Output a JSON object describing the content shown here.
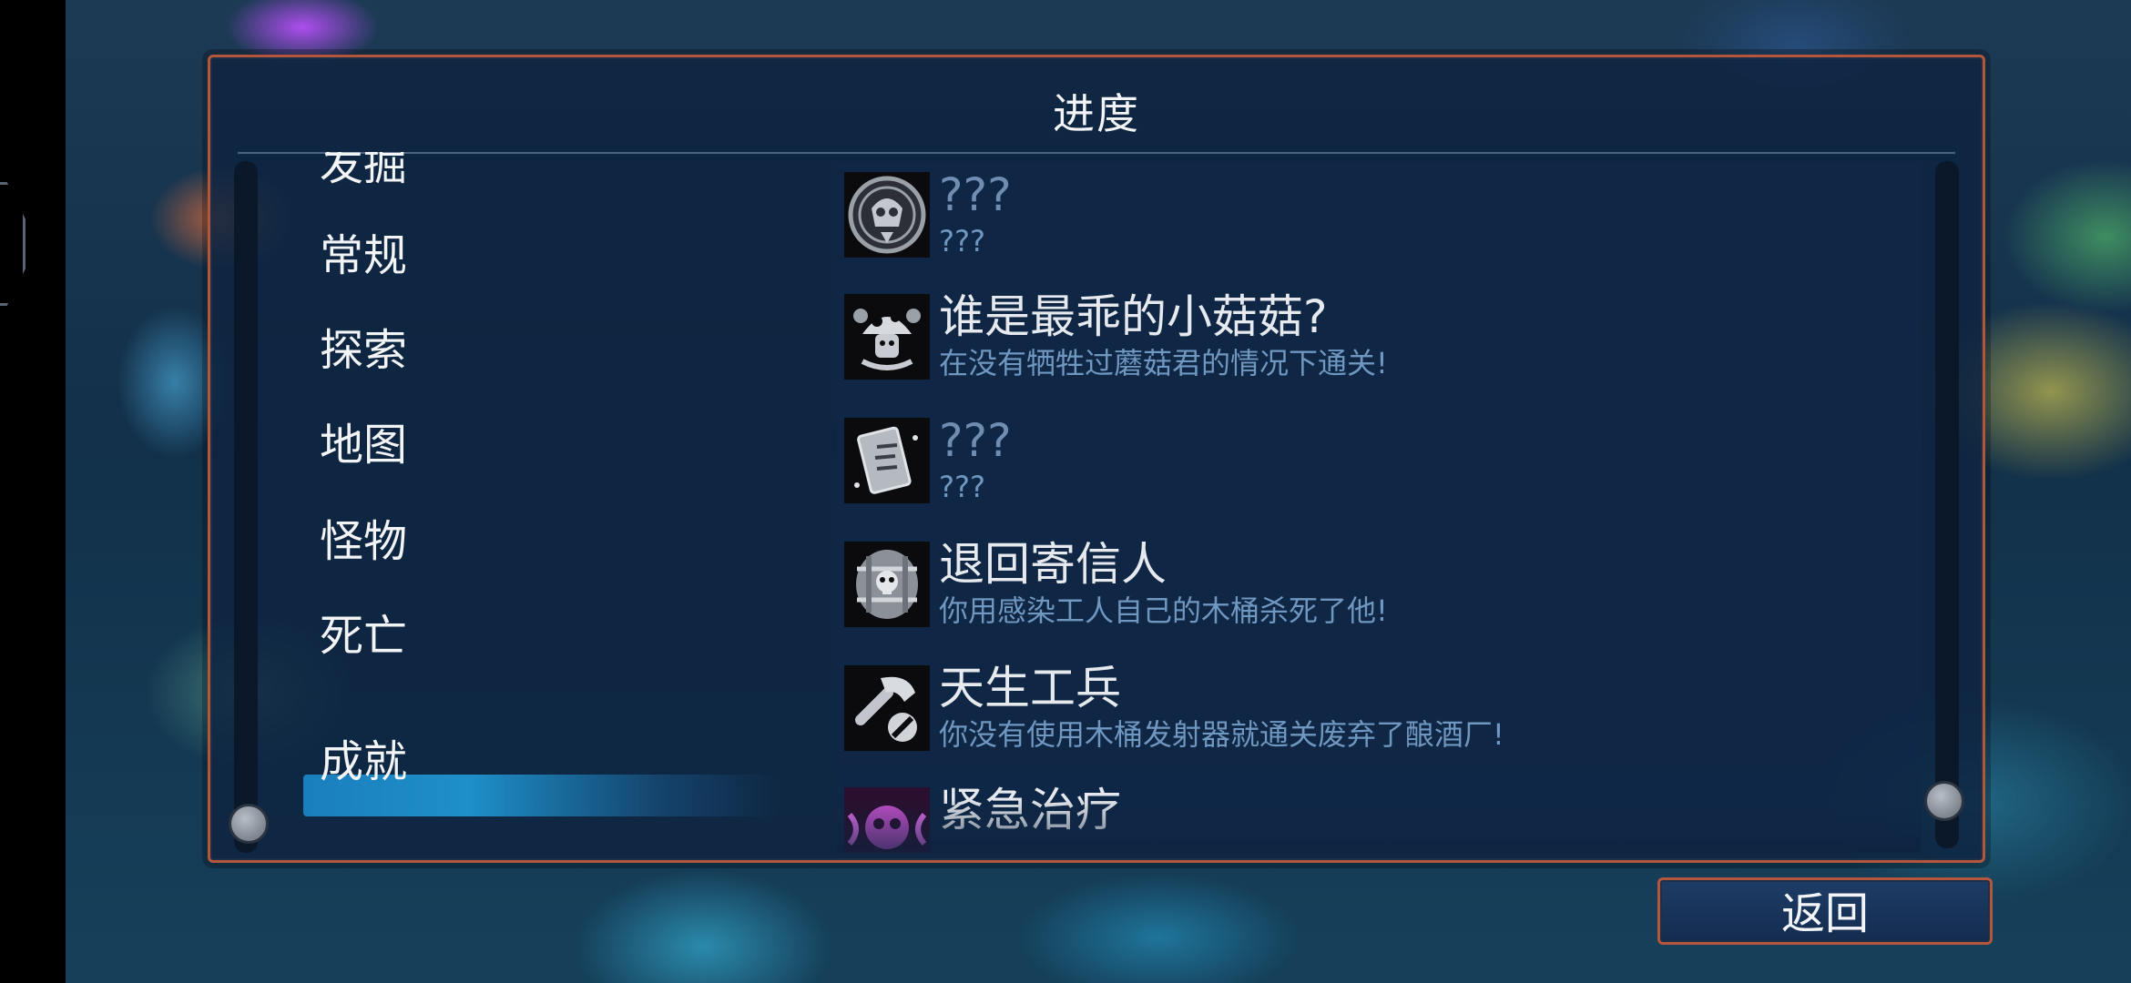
{
  "panel": {
    "title": "进度"
  },
  "categories": {
    "items": [
      "发掘",
      "常规",
      "探索",
      "地图",
      "怪物",
      "死亡",
      "成就"
    ],
    "selected": "成就"
  },
  "achievements": [
    {
      "title": "???",
      "description": "???",
      "icon": "lunar-skull-emblem-icon",
      "locked": true
    },
    {
      "title": "谁是最乖的小菇菇?",
      "description": "在没有牺牲过蘑菇君的情况下通关!",
      "icon": "mushroom-buddy-icon",
      "locked": false
    },
    {
      "title": "???",
      "description": "???",
      "icon": "rune-card-icon",
      "locked": true
    },
    {
      "title": "退回寄信人",
      "description": "你用感染工人自己的木桶杀死了他!",
      "icon": "skull-barrel-icon",
      "locked": false
    },
    {
      "title": "天生工兵",
      "description": "你没有使用木桶发射器就通关废弃了酿酒厂!",
      "icon": "hammer-crossed-out-icon",
      "locked": false
    },
    {
      "title": "紧急治疗",
      "description": "",
      "icon": "pink-skull-icon",
      "locked": false
    }
  ],
  "back_button": {
    "label": "返回"
  },
  "colors": {
    "frame": "#b4563c",
    "selected": "#1e8fc9",
    "description": "#6f97bf"
  }
}
